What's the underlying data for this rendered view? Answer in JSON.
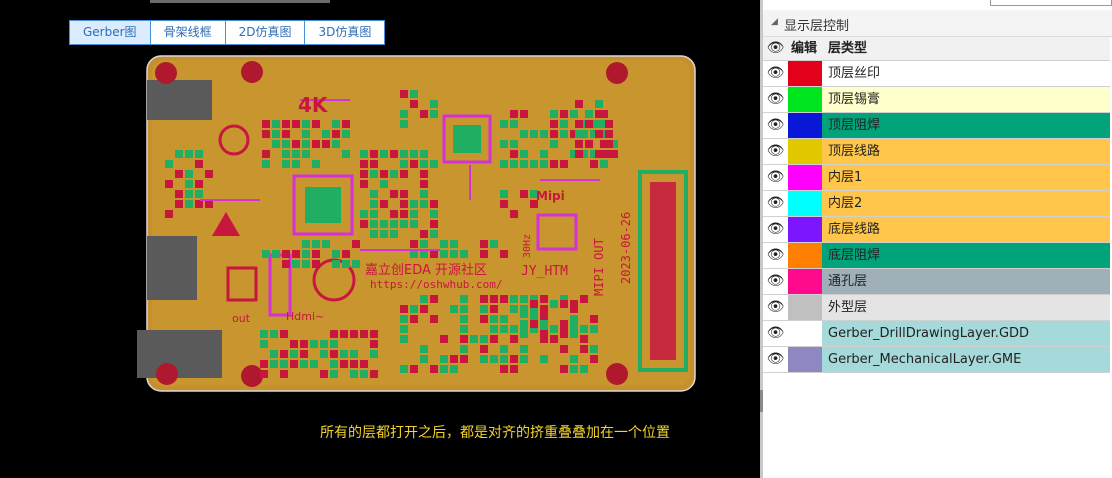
{
  "view_tabs": [
    {
      "label": "Gerber图",
      "active": true
    },
    {
      "label": "骨架线框",
      "active": false
    },
    {
      "label": "2D仿真图",
      "active": false
    },
    {
      "label": "3D仿真图",
      "active": false
    }
  ],
  "board": {
    "silk_text": {
      "brand_line": "嘉立创EDA 开源社区",
      "url": "https://oshwhub.com/",
      "author": "JY_HTM",
      "date": "2023-06-26",
      "label_4k": "4K",
      "label_hdmi": "Hdmi~",
      "label_mipi": "MIPI OUT",
      "label_out": "out",
      "label_mipi_logo": "Mipi",
      "label_hz": "30Hz"
    },
    "colors": {
      "background": "#000000",
      "board_fill": "#c58f2e",
      "copper": "#d5b226",
      "pad": "#1fae62",
      "trace_red": "#c7173f",
      "magenta": "#d431d8",
      "outline": "#d9d9d9"
    }
  },
  "caption": "所有的层都打开之后，都是对齐的挤重叠叠加在一个位置",
  "layer_panel": {
    "title": "显示层控制",
    "columns": {
      "visible": "eye-icon",
      "edit": "编辑",
      "type": "层类型"
    },
    "layers": [
      {
        "name": "顶层丝印",
        "color": "#e3001a",
        "row_bg": "#ffffff"
      },
      {
        "name": "顶层锡膏",
        "color": "#00e61e",
        "row_bg": "#ffffcc"
      },
      {
        "name": "顶层阻焊",
        "color": "#0a17d6",
        "row_bg": "#00a37a"
      },
      {
        "name": "顶层线路",
        "color": "#e2c800",
        "row_bg": "#ffc64b"
      },
      {
        "name": "内层1",
        "color": "#ff00ff",
        "row_bg": "#ffc64b"
      },
      {
        "name": "内层2",
        "color": "#00ffff",
        "row_bg": "#ffc64b"
      },
      {
        "name": "底层线路",
        "color": "#7b16ff",
        "row_bg": "#ffc64b"
      },
      {
        "name": "底层阻焊",
        "color": "#ff8000",
        "row_bg": "#00a37a"
      },
      {
        "name": "通孔层",
        "color": "#ff0a8c",
        "row_bg": "#9fb0b8"
      },
      {
        "name": "外型层",
        "color": "#c0c0c0",
        "row_bg": "#e4e4e4"
      },
      {
        "name": "Gerber_DrillDrawingLayer.GDD",
        "color": "#ffffff",
        "row_bg": "#a5d9da"
      },
      {
        "name": "Gerber_MechanicalLayer.GME",
        "color": "#8d88c2",
        "row_bg": "#a5d9da"
      }
    ]
  }
}
